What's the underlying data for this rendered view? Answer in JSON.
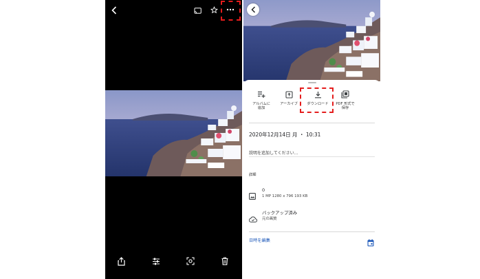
{
  "left": {
    "top_icons": [
      "back-arrow-icon",
      "cast-icon",
      "star-icon",
      "more-options-icon"
    ],
    "bottom_icons": [
      "share-icon",
      "edit-sliders-icon",
      "lens-icon",
      "trash-icon"
    ]
  },
  "right": {
    "actions": [
      {
        "icon": "add-to-album-icon",
        "label": "アルバムに\n追加"
      },
      {
        "icon": "archive-icon",
        "label": "アーカイブ"
      },
      {
        "icon": "download-icon",
        "label": "ダウンロード"
      },
      {
        "icon": "pdf-icon",
        "label": "PDF 形式で\n保存"
      }
    ],
    "date_text": "2020年12月14日 月 ・ 10:31",
    "description_placeholder": "説明を追加してください…",
    "details_heading": "詳細",
    "file": {
      "name": "0",
      "meta": "1 MP   1280 x 796   193 KB"
    },
    "backup": {
      "title": "バックアップ済み",
      "subtitle": "元の画質"
    },
    "edit_datetime_label": "日時を編集"
  },
  "highlight_color": "#e41c1c",
  "link_color": "#1a56b8"
}
